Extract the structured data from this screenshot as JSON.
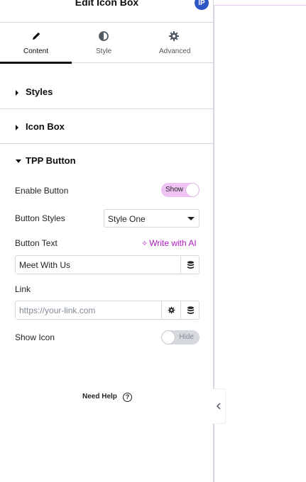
{
  "header": {
    "title": "Edit Icon Box",
    "badge_icon": "elementor-badge-icon"
  },
  "tabs": [
    {
      "label": "Content",
      "icon": "pencil-icon",
      "active": true
    },
    {
      "label": "Style",
      "icon": "half-circle-icon",
      "active": false
    },
    {
      "label": "Advanced",
      "icon": "gear-icon",
      "active": false
    }
  ],
  "sections": [
    {
      "title": "Styles",
      "expanded": false
    },
    {
      "title": "Icon Box",
      "expanded": false
    },
    {
      "title": "TPP Button",
      "expanded": true
    }
  ],
  "tpp_button": {
    "enable_button": {
      "label": "Enable Button",
      "state": "Show"
    },
    "button_styles": {
      "label": "Button Styles",
      "value": "Style One"
    },
    "button_text": {
      "label": "Button Text",
      "ai_label": "Write with AI",
      "value": "Meet With Us"
    },
    "link": {
      "label": "Link",
      "placeholder": "https://your-link.com"
    },
    "show_icon": {
      "label": "Show Icon",
      "state": "Hide"
    }
  },
  "footer": {
    "need_help": "Need Help"
  },
  "colors": {
    "accent": "#b319c7",
    "switch_on": "#f0c2f5",
    "switch_off": "#d5d8dc",
    "border": "#d5d8dc"
  }
}
